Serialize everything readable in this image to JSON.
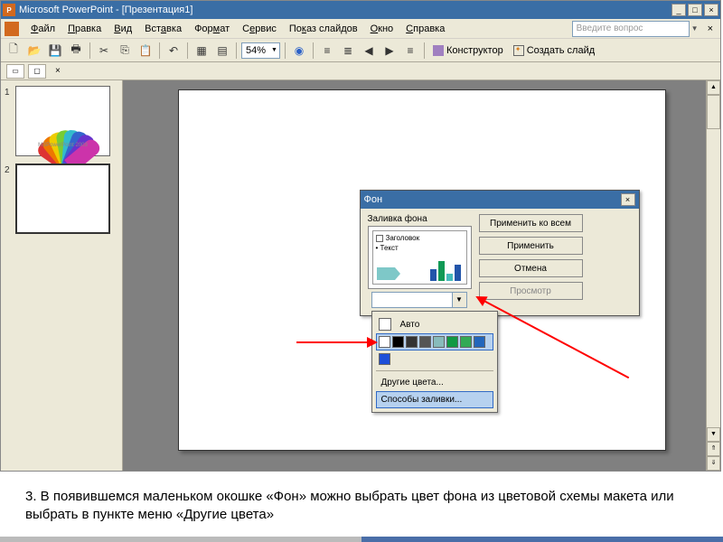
{
  "title_bar": {
    "app": "Microsoft PowerPoint",
    "doc": "[Презентация1]"
  },
  "window_buttons": {
    "min": "_",
    "max": "□",
    "close": "×"
  },
  "menu": {
    "file": "Файл",
    "edit": "Правка",
    "view": "Вид",
    "insert": "Вставка",
    "format": "Формат",
    "service": "Сервис",
    "slideshow": "Показ слайдов",
    "window": "Окно",
    "help": "Справка"
  },
  "ask_box": {
    "placeholder": "Введите вопрос"
  },
  "toolbar": {
    "zoom": "54%",
    "designer": "Конструктор",
    "new_slide": "Создать слайд"
  },
  "thumbs": {
    "n1": "1",
    "n2": "2",
    "cap1": "MSPowerPoint 2003"
  },
  "bg_dialog": {
    "title": "Фон",
    "fill_label": "Заливка фона",
    "preview_title": "Заголовок",
    "preview_text": "Текст",
    "apply_all": "Применить ко всем",
    "apply": "Применить",
    "cancel": "Отмена",
    "preview_btn": "Просмотр"
  },
  "color_popup": {
    "auto": "Авто",
    "more": "Другие цвета...",
    "fill_methods": "Способы заливки...",
    "swatches": [
      "#ffffff",
      "#000000",
      "#333333",
      "#555555",
      "#88bbbb",
      "#119944",
      "#33aa55",
      "#2266bb"
    ]
  },
  "caption": "3.   В появившемся маленьком окошке «Фон» можно выбрать цвет фона из цветовой схемы макета или выбрать в пункте меню «Другие цвета»"
}
